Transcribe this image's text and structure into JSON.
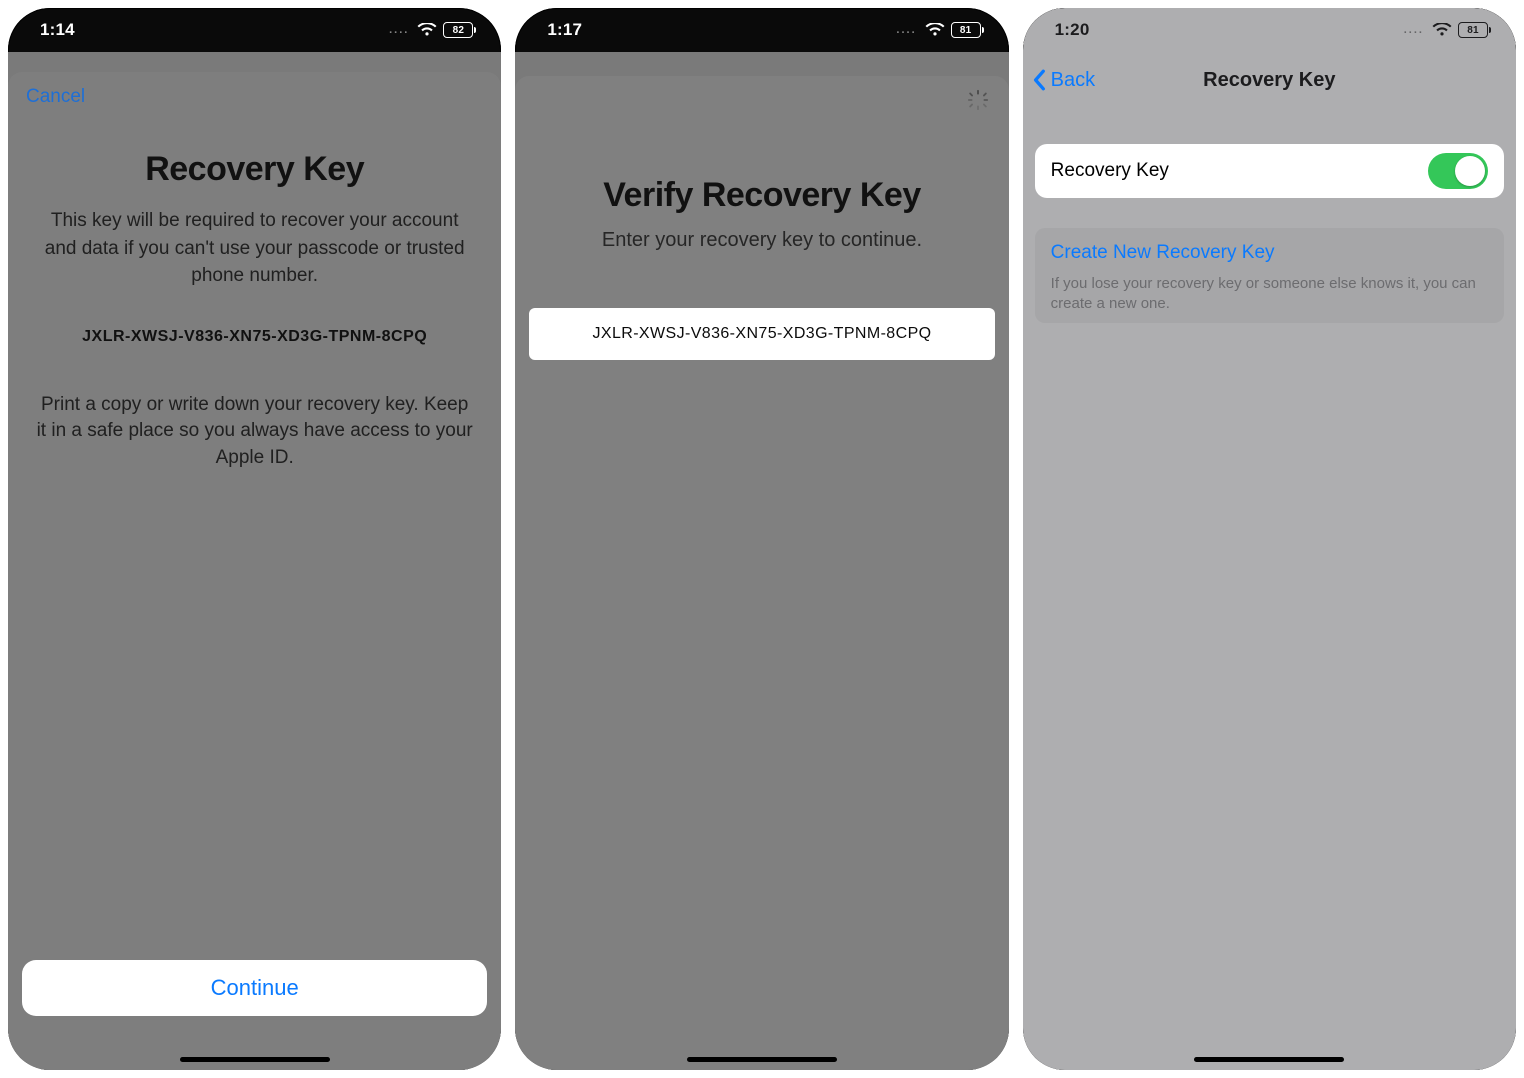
{
  "screens": [
    {
      "status": {
        "time": "1:14",
        "battery": "82"
      },
      "nav": {
        "cancel": "Cancel"
      },
      "title": "Recovery Key",
      "body": "This key will be required to recover your account and data if you can't use your passcode or trusted phone number.",
      "key": "JXLR-XWSJ-V836-XN75-XD3G-TPNM-8CPQ",
      "note": "Print a copy or write down your recovery key. Keep it in a safe place so you always have access to your Apple ID.",
      "continue": "Continue"
    },
    {
      "status": {
        "time": "1:17",
        "battery": "81"
      },
      "title": "Verify Recovery Key",
      "subtitle": "Enter your recovery key to continue.",
      "field_value": "JXLR-XWSJ-V836-XN75-XD3G-TPNM-8CPQ"
    },
    {
      "status": {
        "time": "1:20",
        "battery": "81"
      },
      "nav": {
        "back": "Back",
        "title": "Recovery Key"
      },
      "toggle": {
        "label": "Recovery Key",
        "on": true
      },
      "link": {
        "label": "Create New Recovery Key",
        "footer": "If you lose your recovery key or someone else knows it, you can create a new one."
      }
    }
  ]
}
